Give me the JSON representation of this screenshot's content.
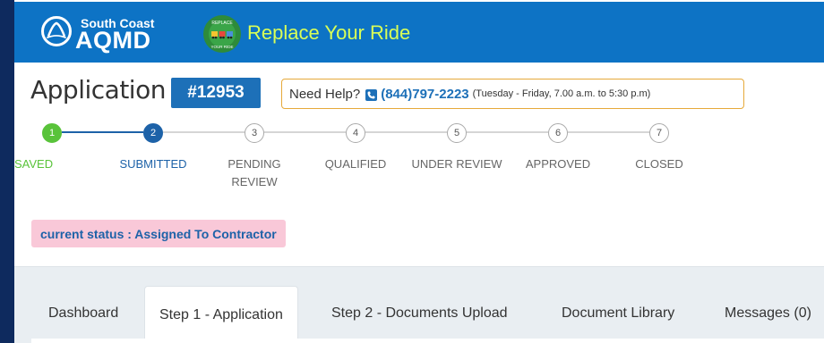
{
  "header": {
    "agency_top": "South Coast",
    "agency_name": "AQMD",
    "program_title": "Replace Your Ride",
    "badge_top_text": "REPLACE",
    "badge_bottom_text": "YOUR RIDE"
  },
  "application": {
    "heading": "Application",
    "number": "#12953",
    "help_label": "Need Help?",
    "phone": "(844)797-2223",
    "hours": "(Tuesday - Friday, 7.00 a.m. to 5:30 p.m)"
  },
  "stepper": {
    "steps": [
      {
        "number": "1",
        "label": "SAVED",
        "state": "done"
      },
      {
        "number": "2",
        "label": "SUBMITTED",
        "state": "current"
      },
      {
        "number": "3",
        "label": "PENDING REVIEW",
        "state": "pending"
      },
      {
        "number": "4",
        "label": "QUALIFIED",
        "state": "pending"
      },
      {
        "number": "5",
        "label": "UNDER REVIEW",
        "state": "pending"
      },
      {
        "number": "6",
        "label": "APPROVED",
        "state": "pending"
      },
      {
        "number": "7",
        "label": "CLOSED",
        "state": "pending"
      }
    ]
  },
  "status": {
    "text": "current status : Assigned To Contractor"
  },
  "tabs": [
    {
      "label": "Dashboard",
      "active": false
    },
    {
      "label": "Step 1 - Application",
      "active": true
    },
    {
      "label": "Step 2 - Documents Upload",
      "active": false
    },
    {
      "label": "Document Library",
      "active": false
    },
    {
      "label": "Messages (0)",
      "active": false
    }
  ],
  "colors": {
    "primary_blue": "#0d73c5",
    "done_green": "#59c33a",
    "current_blue": "#1d62a8",
    "badge_pink": "#f9c8d8",
    "help_border": "#e6a93a"
  }
}
